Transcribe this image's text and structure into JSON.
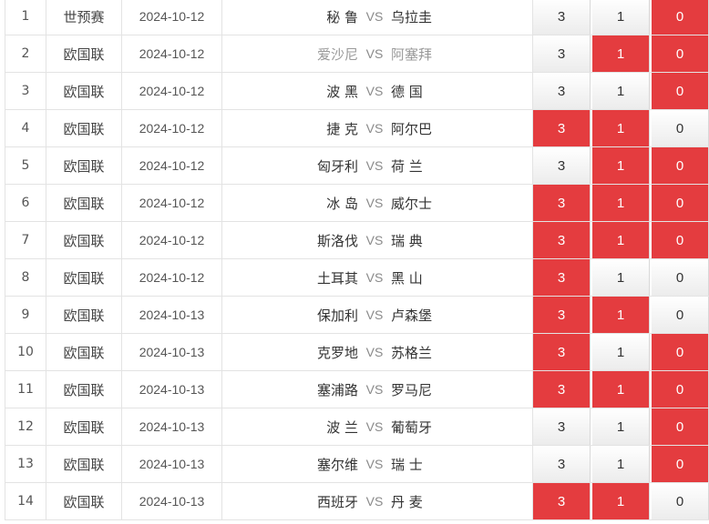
{
  "vs_label": "VS",
  "colors": {
    "selected": "#e43c3f",
    "unselected": "#f3f3f3"
  },
  "rows": [
    {
      "idx": "1",
      "league": "世预赛",
      "date": "2024-10-12",
      "home": "秘 鲁",
      "away": "乌拉圭",
      "o3": "3",
      "o1": "1",
      "o0": "0",
      "sel": [
        false,
        false,
        true
      ],
      "muted": false
    },
    {
      "idx": "2",
      "league": "欧国联",
      "date": "2024-10-12",
      "home": "爱沙尼",
      "away": "阿塞拜",
      "o3": "3",
      "o1": "1",
      "o0": "0",
      "sel": [
        false,
        true,
        true
      ],
      "muted": true
    },
    {
      "idx": "3",
      "league": "欧国联",
      "date": "2024-10-12",
      "home": "波 黑",
      "away": "德 国",
      "o3": "3",
      "o1": "1",
      "o0": "0",
      "sel": [
        false,
        false,
        true
      ],
      "muted": false
    },
    {
      "idx": "4",
      "league": "欧国联",
      "date": "2024-10-12",
      "home": "捷 克",
      "away": "阿尔巴",
      "o3": "3",
      "o1": "1",
      "o0": "0",
      "sel": [
        true,
        true,
        false
      ],
      "muted": false
    },
    {
      "idx": "5",
      "league": "欧国联",
      "date": "2024-10-12",
      "home": "匈牙利",
      "away": "荷 兰",
      "o3": "3",
      "o1": "1",
      "o0": "0",
      "sel": [
        false,
        true,
        true
      ],
      "muted": false
    },
    {
      "idx": "6",
      "league": "欧国联",
      "date": "2024-10-12",
      "home": "冰 岛",
      "away": "威尔士",
      "o3": "3",
      "o1": "1",
      "o0": "0",
      "sel": [
        true,
        true,
        true
      ],
      "muted": false
    },
    {
      "idx": "7",
      "league": "欧国联",
      "date": "2024-10-12",
      "home": "斯洛伐",
      "away": "瑞 典",
      "o3": "3",
      "o1": "1",
      "o0": "0",
      "sel": [
        true,
        true,
        true
      ],
      "muted": false
    },
    {
      "idx": "8",
      "league": "欧国联",
      "date": "2024-10-12",
      "home": "土耳其",
      "away": "黑 山",
      "o3": "3",
      "o1": "1",
      "o0": "0",
      "sel": [
        true,
        false,
        false
      ],
      "muted": false
    },
    {
      "idx": "9",
      "league": "欧国联",
      "date": "2024-10-13",
      "home": "保加利",
      "away": "卢森堡",
      "o3": "3",
      "o1": "1",
      "o0": "0",
      "sel": [
        true,
        true,
        false
      ],
      "muted": false
    },
    {
      "idx": "10",
      "league": "欧国联",
      "date": "2024-10-13",
      "home": "克罗地",
      "away": "苏格兰",
      "o3": "3",
      "o1": "1",
      "o0": "0",
      "sel": [
        true,
        false,
        true
      ],
      "muted": false
    },
    {
      "idx": "11",
      "league": "欧国联",
      "date": "2024-10-13",
      "home": "塞浦路",
      "away": "罗马尼",
      "o3": "3",
      "o1": "1",
      "o0": "0",
      "sel": [
        true,
        true,
        true
      ],
      "muted": false
    },
    {
      "idx": "12",
      "league": "欧国联",
      "date": "2024-10-13",
      "home": "波 兰",
      "away": "葡萄牙",
      "o3": "3",
      "o1": "1",
      "o0": "0",
      "sel": [
        false,
        false,
        true
      ],
      "muted": false
    },
    {
      "idx": "13",
      "league": "欧国联",
      "date": "2024-10-13",
      "home": "塞尔维",
      "away": "瑞 士",
      "o3": "3",
      "o1": "1",
      "o0": "0",
      "sel": [
        false,
        false,
        true
      ],
      "muted": false
    },
    {
      "idx": "14",
      "league": "欧国联",
      "date": "2024-10-13",
      "home": "西班牙",
      "away": "丹 麦",
      "o3": "3",
      "o1": "1",
      "o0": "0",
      "sel": [
        true,
        true,
        false
      ],
      "muted": false
    }
  ]
}
